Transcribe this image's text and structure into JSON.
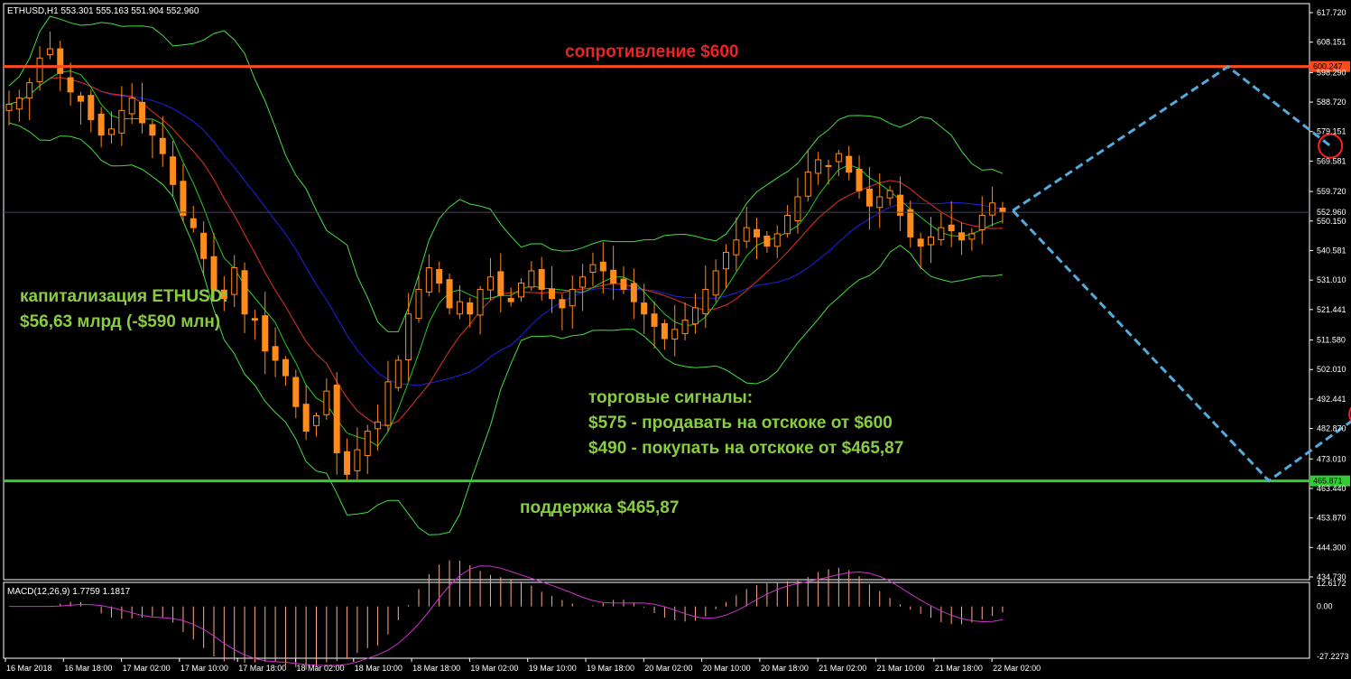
{
  "chart_data": {
    "type": "candlestick",
    "symbol_header": "ETHUSD,H1  553.301 555.163 551.904 552.960",
    "price_axis_ticks": [
      "617.720",
      "608.151",
      "598.290",
      "588.720",
      "579.151",
      "569.581",
      "559.720",
      "550.150",
      "540.581",
      "531.010",
      "521.441",
      "511.580",
      "502.010",
      "492.441",
      "482.870",
      "473.010",
      "463.440",
      "453.870",
      "444.300",
      "434.730"
    ],
    "price_min": 434.73,
    "price_max": 617.72,
    "time_axis_labels": [
      "16 Mar 2018",
      "16 Mar 18:00",
      "17 Mar 02:00",
      "17 Mar 10:00",
      "17 Mar 18:00",
      "18 Mar 02:00",
      "18 Mar 10:00",
      "18 Mar 18:00",
      "19 Mar 02:00",
      "19 Mar 10:00",
      "19 Mar 18:00",
      "20 Mar 02:00",
      "20 Mar 10:00",
      "20 Mar 18:00",
      "21 Mar 02:00",
      "21 Mar 10:00",
      "21 Mar 18:00",
      "22 Mar 02:00"
    ],
    "resistance": {
      "price": 600.247,
      "label": "600.247",
      "annotation": "сопротивление $600",
      "color": "#ff4a1c"
    },
    "support": {
      "price": 465.871,
      "label": "465.871",
      "annotation": "поддержка $465,87",
      "color": "#33cc33"
    },
    "current_price_label": "552.960",
    "close_path": [
      588,
      590,
      595,
      603,
      606,
      598,
      592,
      589,
      583,
      578,
      580,
      586,
      590,
      582,
      578,
      572,
      562,
      552,
      548,
      538,
      528,
      525,
      535,
      520,
      518,
      508,
      505,
      500,
      490,
      482,
      487,
      495,
      475,
      468,
      476,
      482,
      485,
      498,
      505,
      520,
      528,
      535,
      530,
      522,
      524,
      520,
      528,
      532,
      526,
      524,
      530,
      534,
      528,
      525,
      522,
      528,
      532,
      536,
      534,
      530,
      528,
      524,
      520,
      516,
      512,
      515,
      518,
      522,
      528,
      534,
      540,
      544,
      548,
      545,
      542,
      546,
      552,
      558,
      566,
      570,
      568,
      572,
      566,
      560,
      555,
      558,
      560,
      552,
      545,
      542,
      545,
      548,
      547,
      544,
      546,
      552,
      556,
      553
    ],
    "annotations": {
      "cap_line1": "капитализация ETHUSD:",
      "cap_line2": "$56,63 млрд (-$590 млн)",
      "signals_title": "торговые сигналы:",
      "signal_sell": "$575 - продавать на отскоке от $600",
      "signal_buy": "$490 - покупать на отскоке от $465,87"
    },
    "forecast_path": [
      {
        "bar": 98,
        "price": 553.5
      },
      {
        "bar": 119,
        "price": 600.2
      },
      {
        "bar": 129,
        "price": 574.5
      }
    ],
    "forecast_path2": [
      {
        "bar": 98,
        "price": 553.5
      },
      {
        "bar": 123,
        "price": 465.9
      },
      {
        "bar": 132,
        "price": 487.5
      }
    ],
    "macd": {
      "header": "MACD(12,26,9) 1.7759 1.1817",
      "ticks": [
        "12.6172",
        "0.00",
        "-27.2273"
      ],
      "max": 12.6172,
      "min": -27.2273
    },
    "colors": {
      "bull": "#000000",
      "bear": "#ff8c1a",
      "ma_red": "#e02020",
      "ma_blue": "#2020e6",
      "ma_green": "#22cc22",
      "bollinger": "#44dd44",
      "forecast": "#55aadd",
      "circle": "#ff2020",
      "macd_hist": "#ffaa88",
      "macd_signal": "#cc33cc",
      "annotation_green": "#88cc44",
      "annotation_red": "#ee2222"
    }
  }
}
